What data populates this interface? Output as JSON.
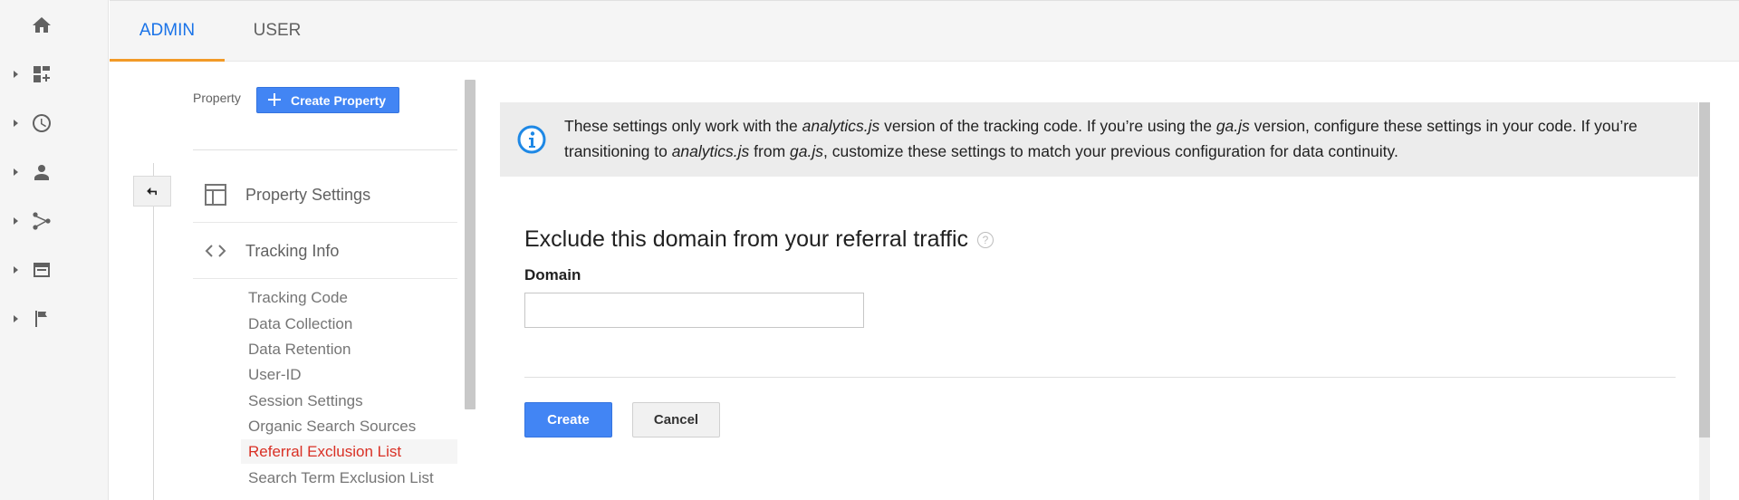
{
  "rail": {
    "items": [
      {
        "icon": "home-icon",
        "has_caret": false
      },
      {
        "icon": "dashboard-add-icon",
        "has_caret": true
      },
      {
        "icon": "clock-icon",
        "has_caret": true
      },
      {
        "icon": "person-icon",
        "has_caret": true
      },
      {
        "icon": "acquisition-icon",
        "has_caret": true
      },
      {
        "icon": "behavior-icon",
        "has_caret": true
      },
      {
        "icon": "flag-icon",
        "has_caret": true
      }
    ]
  },
  "tabs": [
    {
      "label": "ADMIN",
      "active": true
    },
    {
      "label": "USER",
      "active": false
    }
  ],
  "property_column": {
    "label": "Property",
    "create_button": "Create Property",
    "sections": [
      {
        "label": "Property Settings",
        "icon": "layout-icon"
      },
      {
        "label": "Tracking Info",
        "icon": "code-icon"
      }
    ],
    "sub_items": [
      {
        "label": "Tracking Code",
        "active": false
      },
      {
        "label": "Data Collection",
        "active": false
      },
      {
        "label": "Data Retention",
        "active": false
      },
      {
        "label": "User-ID",
        "active": false
      },
      {
        "label": "Session Settings",
        "active": false
      },
      {
        "label": "Organic Search Sources",
        "active": false
      },
      {
        "label": "Referral Exclusion List",
        "active": true
      },
      {
        "label": "Search Term Exclusion List",
        "active": false
      }
    ]
  },
  "info": {
    "p1": "These settings only work with the ",
    "i1": "analytics.js",
    "p2": " version of the tracking code. If you’re using the ",
    "i2": "ga.js",
    "p3": " version, configure these settings in your code. If you’re transitioning to ",
    "i3": "analytics.js",
    "p4": " from ",
    "i4": "ga.js",
    "p5": ", customize these settings to match your previous configuration for data continuity."
  },
  "form": {
    "heading": "Exclude this domain from your referral traffic",
    "help": "?",
    "domain_label": "Domain",
    "domain_value": "",
    "create_label": "Create",
    "cancel_label": "Cancel"
  },
  "colors": {
    "accent": "#4285f4",
    "active_tab": "#1a73e8",
    "tab_underline": "#f29a27",
    "active_item": "#d93025"
  }
}
